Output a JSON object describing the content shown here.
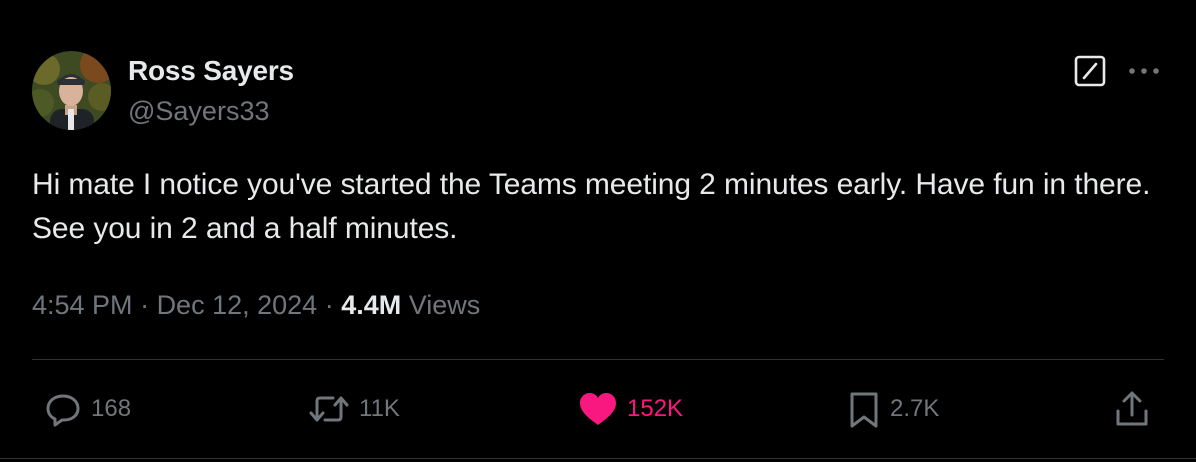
{
  "author": {
    "display_name": "Ross Sayers",
    "handle": "@Sayers33"
  },
  "tweet": {
    "text": "Hi mate I notice you've started the Teams meeting 2 minutes early. Have fun in there. See you in 2 and a half minutes.",
    "time": "4:54 PM",
    "date": "Dec 12, 2024",
    "separator": " · ",
    "views_count": "4.4M",
    "views_label": " Views"
  },
  "actions": {
    "replies": "168",
    "reposts": "11K",
    "likes": "152K",
    "bookmarks": "2.7K"
  },
  "colors": {
    "background": "#000000",
    "text_primary": "#e7e9ea",
    "text_secondary": "#71767b",
    "like_active": "#f91880",
    "divider": "#2f3336"
  },
  "icons": {
    "grok": "grok-icon",
    "more": "more-icon",
    "reply": "reply-icon",
    "repost": "repost-icon",
    "like": "heart-icon",
    "bookmark": "bookmark-icon",
    "share": "share-icon"
  }
}
